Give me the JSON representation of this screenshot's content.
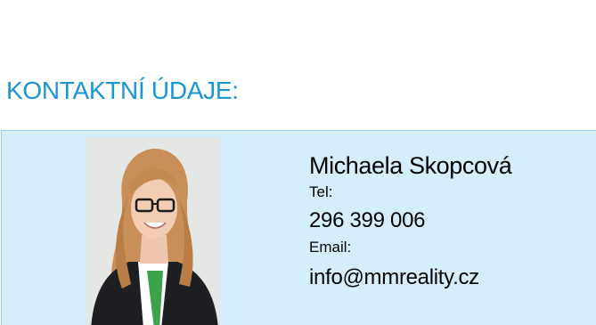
{
  "section": {
    "title": "KONTAKTNÍ ÚDAJE:"
  },
  "contact": {
    "name": "Michaela Skopcová",
    "tel_label": "Tel:",
    "tel_value": "296 399 006",
    "email_label": "Email:",
    "email_value": "info@mmreality.cz",
    "photo_icon": "agent-photo"
  },
  "colors": {
    "title": "#1a96d4",
    "box_background": "#d4eefb",
    "box_border": "#9fd2ee"
  }
}
